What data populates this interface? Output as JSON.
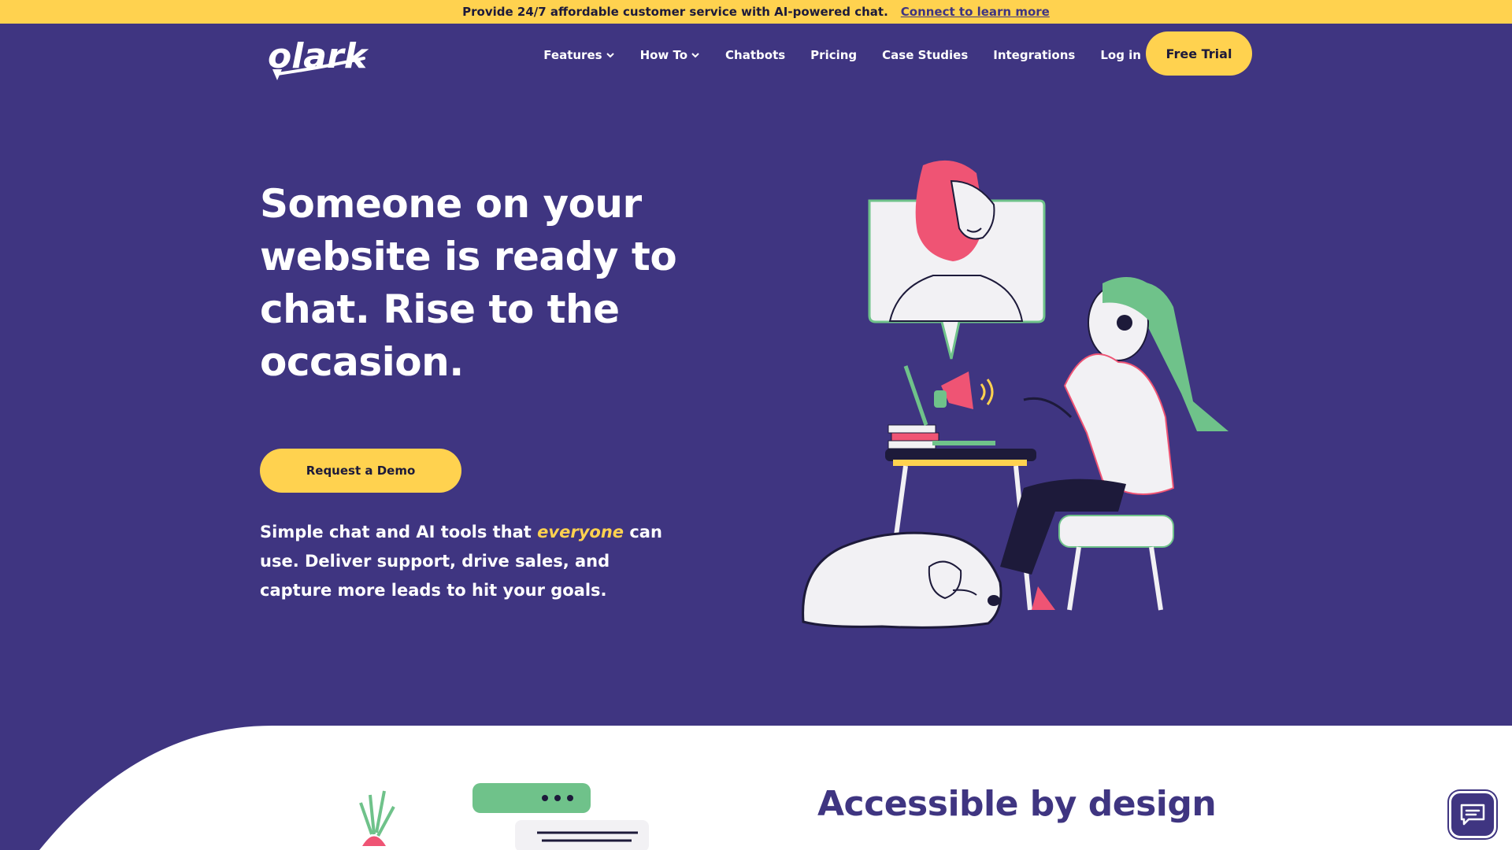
{
  "announcement": {
    "text": "Provide 24/7 affordable customer service with AI-powered chat.",
    "link_label": "Connect to learn more"
  },
  "brand": {
    "logo_text": "olark"
  },
  "nav": {
    "items": [
      {
        "label": "Features",
        "dropdown": true
      },
      {
        "label": "How To",
        "dropdown": true
      },
      {
        "label": "Chatbots",
        "dropdown": false
      },
      {
        "label": "Pricing",
        "dropdown": false
      },
      {
        "label": "Case Studies",
        "dropdown": false
      },
      {
        "label": "Integrations",
        "dropdown": false
      },
      {
        "label": "Log in",
        "dropdown": false
      }
    ],
    "cta_label": "Free Trial"
  },
  "hero": {
    "title": "Someone on your website is ready to chat. Rise to the occasion.",
    "demo_button": "Request a Demo",
    "subtitle_before": "Simple chat and AI tools that ",
    "subtitle_emphasis": "everyone",
    "subtitle_after": " can use. Deliver support, drive sales, and capture more leads to hit your goals."
  },
  "section": {
    "title": "Accessible by design"
  },
  "chat_widget": {
    "icon": "chat-bubble-icon"
  },
  "colors": {
    "primary": "#3f3581",
    "accent": "#ffd24f",
    "white": "#ffffff"
  }
}
